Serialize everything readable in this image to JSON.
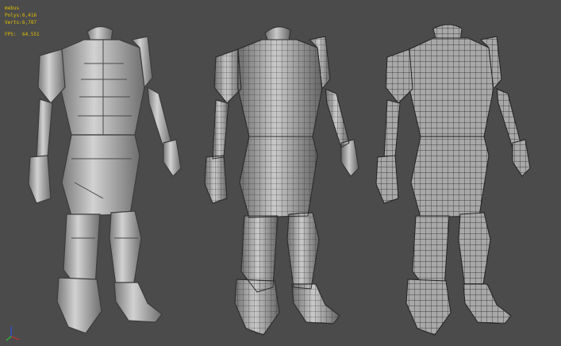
{
  "stats": {
    "object_name": "mebus",
    "polys_label": "Polys:",
    "polys_value": "6,416",
    "verts_label": "Verts:",
    "verts_value": "6,787",
    "fps_label": "FPS:",
    "fps_value": "64.551"
  },
  "colors": {
    "background": "#4b4b4b",
    "stats_text": "#e0c000",
    "shaded_fill": "#bdbdbd",
    "wire_fill_dark": "#8a8a8a",
    "wire_fill_light": "#d6d6d6",
    "gizmo_x": "#d03030",
    "gizmo_y": "#30c030",
    "gizmo_z": "#3050e0"
  },
  "icons": {
    "axis_gizmo": "axis-tripod-icon"
  }
}
